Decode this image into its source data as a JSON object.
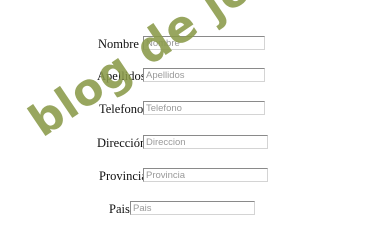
{
  "form": {
    "fields": [
      {
        "label": "Nombre",
        "placeholder": "Nombre"
      },
      {
        "label": "Apellidos",
        "placeholder": "Apellidos"
      },
      {
        "label": "Telefono",
        "placeholder": "Telefono"
      },
      {
        "label": "Dirección",
        "placeholder": "Direccion"
      },
      {
        "label": "Provincia",
        "placeholder": "Provincia"
      },
      {
        "label": "Pais",
        "placeholder": "Pais"
      }
    ]
  },
  "watermark": {
    "text": "blog de joasoft",
    "color": "#8a9a4a"
  }
}
